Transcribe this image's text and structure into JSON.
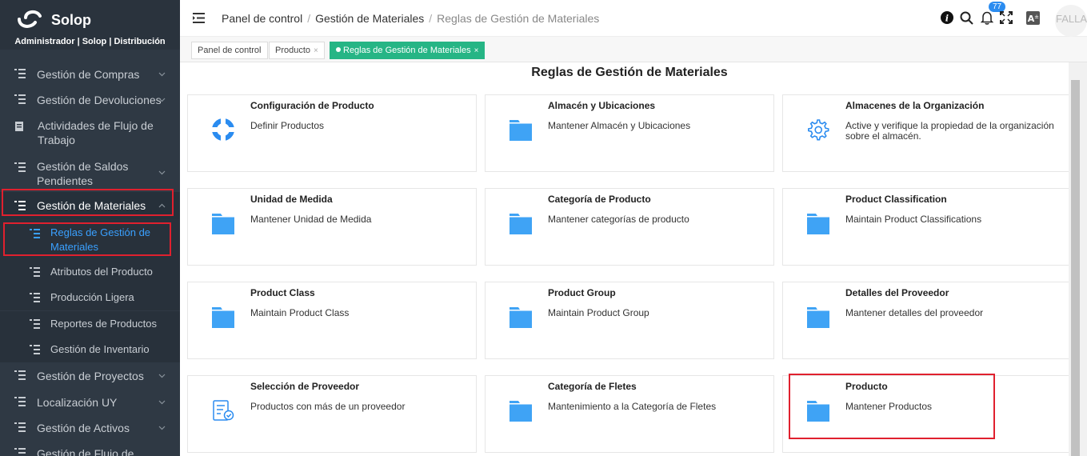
{
  "brand": {
    "name": "Solop",
    "user": "Administrador | Solop | Distribución"
  },
  "sidebar": {
    "items": [
      {
        "label": "Gestión de Compras",
        "chevron": true
      },
      {
        "label": "Gestión de Devoluciones",
        "chevron": true
      },
      {
        "label": "Actividades de Flujo de Trabajo",
        "chevron": false
      },
      {
        "label": "Gestión de Saldos Pendientes",
        "chevron": true
      },
      {
        "label": "Gestión de Materiales",
        "chevron": true
      },
      {
        "label": "Gestión de Proyectos",
        "chevron": true
      },
      {
        "label": "Localización UY",
        "chevron": true
      },
      {
        "label": "Gestión de Activos",
        "chevron": true
      },
      {
        "label": "Gestión de Flujo de",
        "chevron": false
      }
    ],
    "subitems": [
      {
        "label": "Reglas de Gestión de Materiales"
      },
      {
        "label": "Atributos del Producto"
      },
      {
        "label": "Producción Ligera"
      },
      {
        "label": "Reportes de Productos"
      },
      {
        "label": "Gestión de Inventario"
      }
    ]
  },
  "header": {
    "breadcrumb": [
      "Panel de control",
      "Gestión de Materiales",
      "Reglas de Gestión de Materiales"
    ],
    "breadcrumb_sep": "/",
    "notifications": "77",
    "user_label": "FALLA"
  },
  "tabs": [
    {
      "label": "Panel de control",
      "closable": false
    },
    {
      "label": "Producto",
      "closable": true
    },
    {
      "label": "Reglas de Gestión de Materiales",
      "closable": true
    }
  ],
  "tab_close_glyph": "×",
  "main": {
    "title": "Reglas de Gestión de Materiales",
    "cards": [
      {
        "title": "Configuración de Producto",
        "desc": "Definir Productos",
        "icon": "lifebuoy-icon"
      },
      {
        "title": "Almacén y Ubicaciones",
        "desc": "Mantener Almacén y Ubicaciones",
        "icon": "folder-icon"
      },
      {
        "title": "Almacenes de la Organización",
        "desc": "Active y verifique la propiedad de la organización sobre el almacén.",
        "icon": "gear-icon"
      },
      {
        "title": "Unidad de Medida",
        "desc": "Mantener Unidad de Medida",
        "icon": "folder-icon"
      },
      {
        "title": "Categoría de Producto",
        "desc": "Mantener categorías de producto",
        "icon": "folder-icon"
      },
      {
        "title": "Product Classification",
        "desc": "Maintain Product Classifications",
        "icon": "folder-icon"
      },
      {
        "title": "Product Class",
        "desc": "Maintain Product Class",
        "icon": "folder-icon"
      },
      {
        "title": "Product Group",
        "desc": "Maintain Product Group",
        "icon": "folder-icon"
      },
      {
        "title": "Detalles del Proveedor",
        "desc": "Mantener detalles del proveedor",
        "icon": "folder-icon"
      },
      {
        "title": "Selección de Proveedor",
        "desc": "Productos con más de un proveedor",
        "icon": "checklist-icon"
      },
      {
        "title": "Categoría de Fletes",
        "desc": "Mantenimiento a la Categoría de Fletes",
        "icon": "folder-icon"
      },
      {
        "title": "Producto",
        "desc": "Mantener Productos",
        "icon": "folder-icon"
      }
    ]
  },
  "colors": {
    "accent": "#3aa0ff",
    "tab_active": "#26b585",
    "highlight": "#e0202e",
    "sidebar_bg": "#2f3944"
  }
}
